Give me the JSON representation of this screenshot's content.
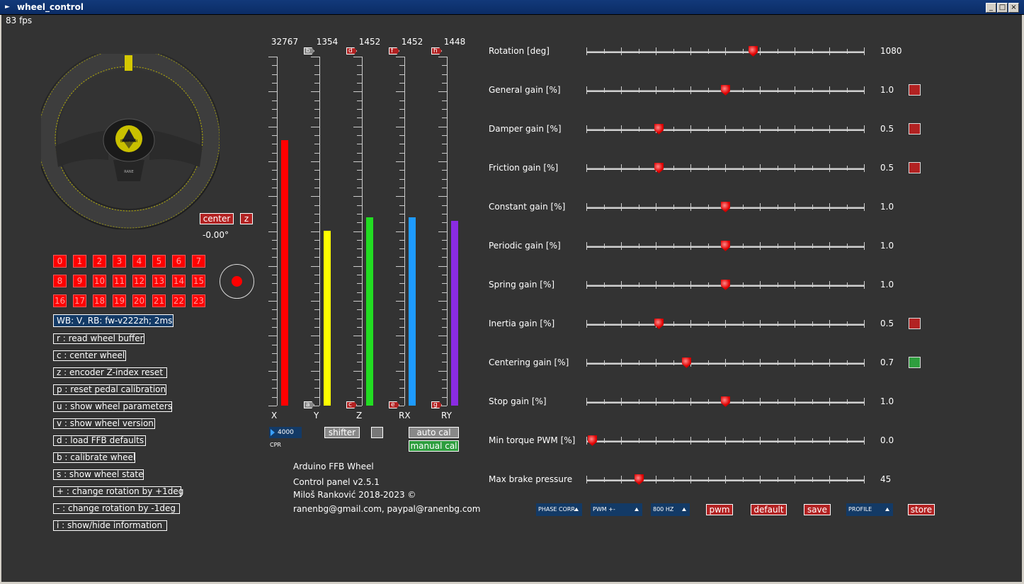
{
  "window": {
    "title": "wheel_control"
  },
  "fps": "83 fps",
  "wheel": {
    "hub_text": "BRATTAOI",
    "spoke_text": "RANE",
    "center_button": "center",
    "z_button": "z",
    "angle": "-0.00°"
  },
  "buttons_grid": [
    "0",
    "1",
    "2",
    "3",
    "4",
    "5",
    "6",
    "7",
    "8",
    "9",
    "10",
    "11",
    "12",
    "13",
    "14",
    "15",
    "16",
    "17",
    "18",
    "19",
    "20",
    "21",
    "22",
    "23"
  ],
  "info_box": "WB: V, RB: fw-v222zh; 2ms",
  "commands": [
    "r : read wheel buffer",
    "c : center wheel",
    "z : encoder Z-index reset",
    "p : reset pedal calibration",
    "u : show wheel parameters",
    "v : show wheel version",
    "d : load FFB defaults",
    "b : calibrate wheel",
    "s : show wheel state",
    "+ : change rotation by +1deg",
    "- : change rotation by -1deg",
    "i : show/hide information"
  ],
  "axes": [
    {
      "label": "X",
      "top": "32767",
      "color": "#ff0000",
      "fill": 0.76,
      "flag_top": "",
      "flag_bottom": ""
    },
    {
      "label": "Y",
      "top": "1354",
      "color": "#ffff00",
      "fill": 0.5,
      "flag_top": "b",
      "flag_bottom": "a"
    },
    {
      "label": "Z",
      "top": "1452",
      "color": "#22dd22",
      "fill": 0.54,
      "flag_top": "d",
      "flag_bottom": "c"
    },
    {
      "label": "RX",
      "top": "1452",
      "color": "#1e9bff",
      "fill": 0.54,
      "flag_top": "f",
      "flag_bottom": "e"
    },
    {
      "label": "RY",
      "top": "1448",
      "color": "#8a2be2",
      "fill": 0.53,
      "flag_top": "h",
      "flag_bottom": "g"
    }
  ],
  "cpr": {
    "value": "4000",
    "label": "CPR"
  },
  "shifter_button": "shifter",
  "auto_cal": "auto cal",
  "manual_cal": "manual cal",
  "about": {
    "line1": "Arduino FFB Wheel",
    "line2": "Control panel v2.5.1",
    "line3": "Miloš Ranković 2018-2023 ©",
    "line4": "ranenbg@gmail.com, paypal@ranenbg.com"
  },
  "sliders": [
    {
      "label": "Rotation [deg]",
      "value": "1080",
      "pos": 0.6,
      "swatch": ""
    },
    {
      "label": "General gain [%]",
      "value": "1.0",
      "pos": 0.5,
      "swatch": "#b22222"
    },
    {
      "label": "Damper gain [%]",
      "value": "0.5",
      "pos": 0.26,
      "swatch": "#b22222"
    },
    {
      "label": "Friction gain [%]",
      "value": "0.5",
      "pos": 0.26,
      "swatch": "#b22222"
    },
    {
      "label": "Constant gain [%]",
      "value": "1.0",
      "pos": 0.5,
      "swatch": ""
    },
    {
      "label": "Periodic gain [%]",
      "value": "1.0",
      "pos": 0.5,
      "swatch": ""
    },
    {
      "label": "Spring gain [%]",
      "value": "1.0",
      "pos": 0.5,
      "swatch": ""
    },
    {
      "label": "Inertia gain [%]",
      "value": "0.5",
      "pos": 0.26,
      "swatch": "#b22222"
    },
    {
      "label": "Centering gain [%]",
      "value": "0.7",
      "pos": 0.36,
      "swatch": "#2e9e3e"
    },
    {
      "label": "Stop gain [%]",
      "value": "1.0",
      "pos": 0.5,
      "swatch": ""
    },
    {
      "label": "Min torque PWM [%]",
      "value": "0.0",
      "pos": 0.02,
      "swatch": ""
    },
    {
      "label": "Max brake pressure",
      "value": "45",
      "pos": 0.19,
      "swatch": ""
    }
  ],
  "bottom": {
    "phase": "PHASE CORR",
    "pwm_mode": "PWM +-",
    "freq": "800 HZ",
    "pwm": "pwm",
    "default": "default",
    "save": "save",
    "profile": "PROFILE",
    "store": "store"
  }
}
